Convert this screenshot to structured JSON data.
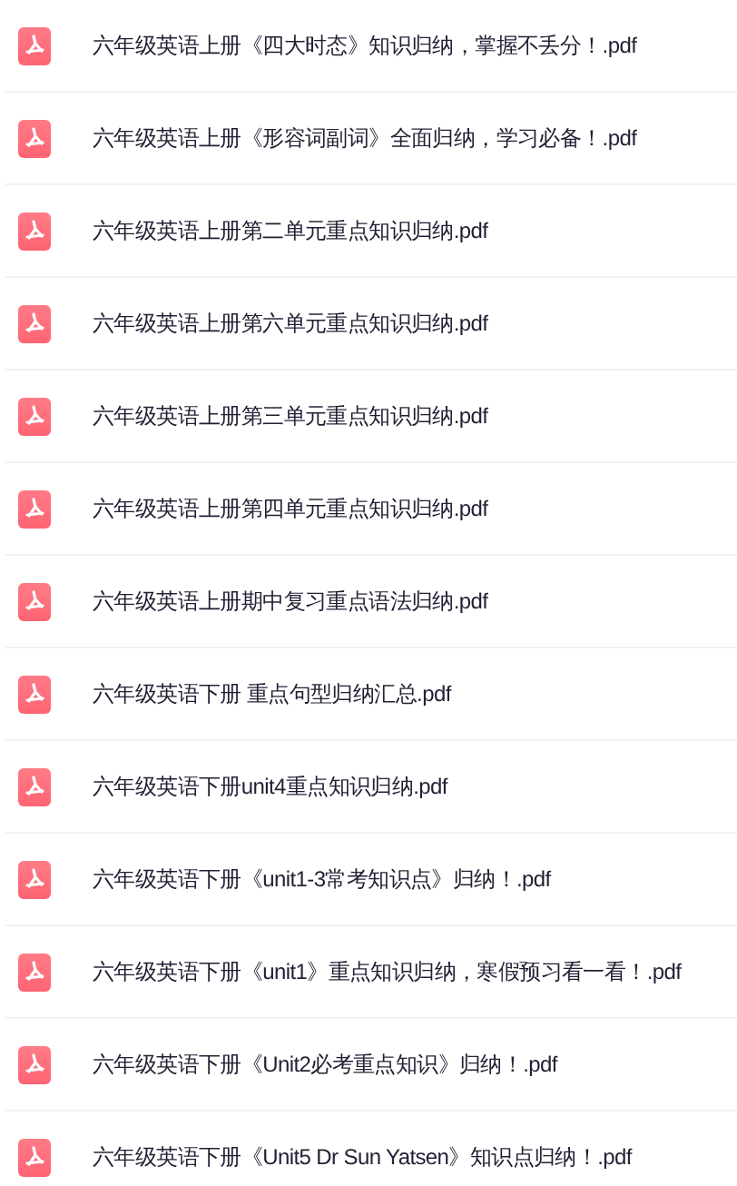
{
  "files": [
    {
      "name": "六年级英语上册《四大时态》知识归纳，掌握不丢分！.pdf"
    },
    {
      "name": "六年级英语上册《形容词副词》全面归纳，学习必备！.pdf"
    },
    {
      "name": "六年级英语上册第二单元重点知识归纳.pdf"
    },
    {
      "name": "六年级英语上册第六单元重点知识归纳.pdf"
    },
    {
      "name": "六年级英语上册第三单元重点知识归纳.pdf"
    },
    {
      "name": "六年级英语上册第四单元重点知识归纳.pdf"
    },
    {
      "name": "六年级英语上册期中复习重点语法归纳.pdf"
    },
    {
      "name": "六年级英语下册 重点句型归纳汇总.pdf"
    },
    {
      "name": "六年级英语下册unit4重点知识归纳.pdf"
    },
    {
      "name": "六年级英语下册《unit1-3常考知识点》归纳！.pdf"
    },
    {
      "name": "六年级英语下册《unit1》重点知识归纳，寒假预习看一看！.pdf"
    },
    {
      "name": "六年级英语下册《Unit2必考重点知识》归纳！.pdf"
    },
    {
      "name": "六年级英语下册《Unit5 Dr Sun Yatsen》知识点归纳！.pdf"
    }
  ]
}
